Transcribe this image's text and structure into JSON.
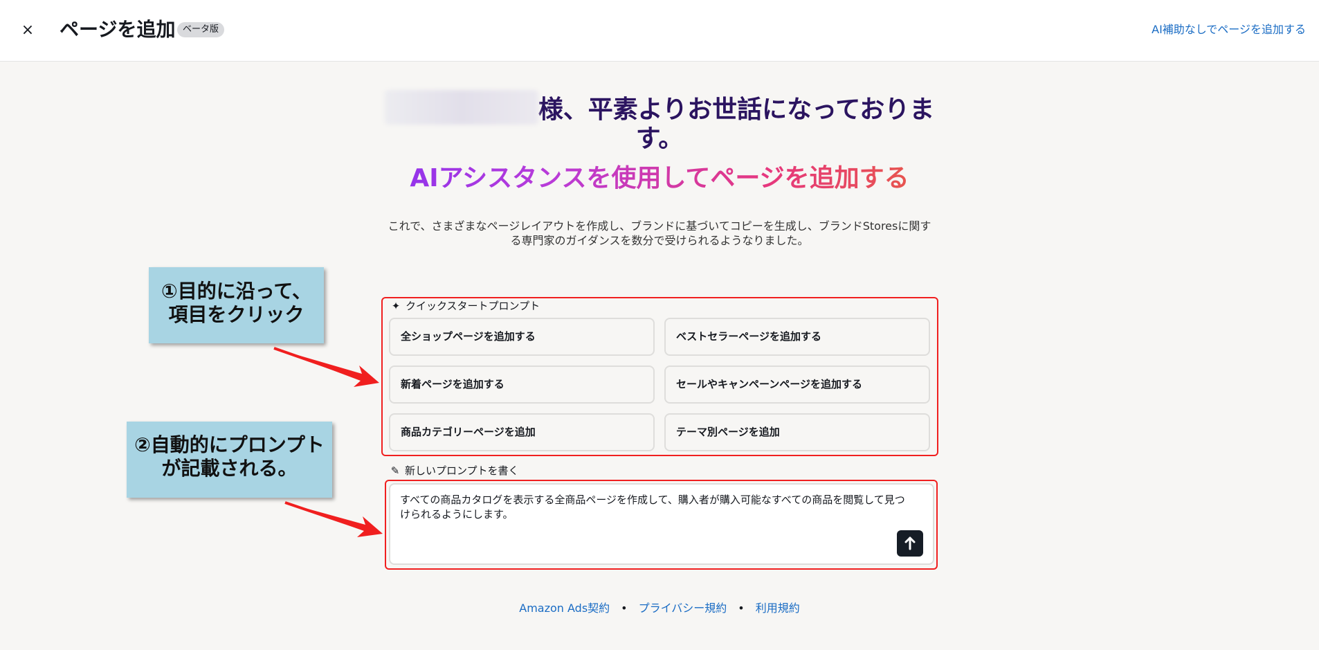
{
  "header": {
    "close_icon": "×",
    "title": "ページを追加",
    "beta_badge": "ベータ版",
    "no_ai_link": "AI補助なしでページを追加する"
  },
  "greeting": {
    "text": "様、平素よりお世話になっております。"
  },
  "subtitle": "AIアシスタンスを使用してページを追加する",
  "description": "これで、さまざまなページレイアウトを作成し、ブランドに基づいてコピーを生成し、ブランドStoresに関する専門家のガイダンスを数分で受けられるようなりました。",
  "annotations": {
    "callout1_line1": "①目的に沿って、",
    "callout1_line2": "項目をクリック",
    "callout2_line1": "②自動的にプロンプト",
    "callout2_line2": "が記載される。"
  },
  "quickstart": {
    "label": "クイックスタートプロンプト",
    "icon": "sparkle-icon",
    "buttons": [
      "全ショップページを追加する",
      "ベストセラーページを追加する",
      "新着ページを追加する",
      "セールやキャンペーンページを追加する",
      "商品カテゴリーページを追加",
      "テーマ別ページを追加"
    ]
  },
  "new_prompt": {
    "label": "新しいプロンプトを書く",
    "icon": "pencil-icon",
    "value": "すべての商品カタログを表示する全商品ページを作成して、購入者が購入可能なすべての商品を閲覧して見つけられるようにします。",
    "send_icon": "arrow-up-icon"
  },
  "footer": {
    "links": [
      "Amazon Ads契約",
      "プライバシー規約",
      "利用規約"
    ],
    "separator": "•"
  },
  "colors": {
    "link": "#1a6cc4",
    "annotation_red": "#f01f1f",
    "callout_bg": "#a8d4e3",
    "greeting": "#2b1460",
    "send_button": "#161d26"
  }
}
